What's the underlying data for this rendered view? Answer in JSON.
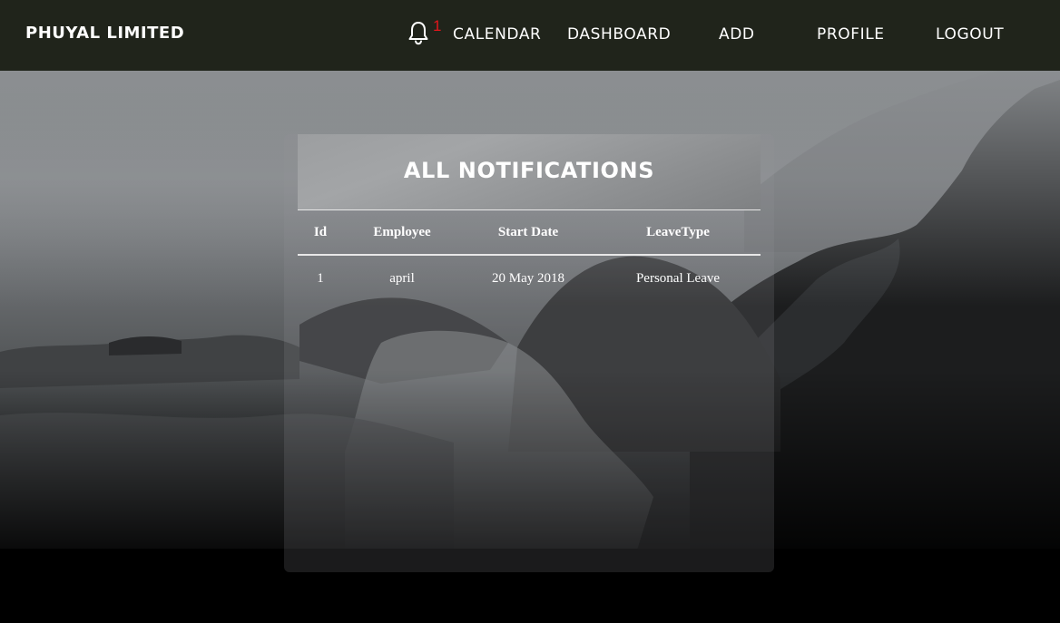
{
  "navbar": {
    "brand": "PHUYAL LIMITED",
    "notification_icon": "bell-icon",
    "notification_count": "1",
    "links": {
      "calendar": "CALENDAR",
      "dashboard": "DASHBOARD",
      "add": "ADD",
      "profile": "PROFILE",
      "logout": "LOGOUT"
    }
  },
  "card": {
    "title": "ALL NOTIFICATIONS"
  },
  "table": {
    "headers": [
      "Id",
      "Employee",
      "Start Date",
      "LeaveType"
    ],
    "rows": [
      [
        "1",
        "april",
        "20 May 2018",
        "Personal Leave"
      ]
    ]
  },
  "colors": {
    "navbar_bg": "#20241b",
    "notification_count": "#e3161c",
    "text": "#ffffff"
  }
}
